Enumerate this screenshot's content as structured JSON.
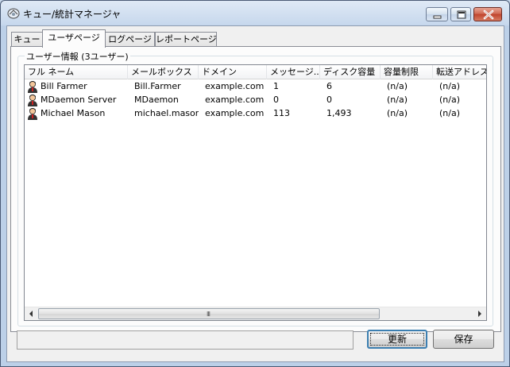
{
  "window": {
    "title": "キュー/統計マネージャ"
  },
  "tabs": [
    {
      "label": "キュー",
      "active": false
    },
    {
      "label": "ユーザページ",
      "active": true
    },
    {
      "label": "ログページ",
      "active": false
    },
    {
      "label": "レポートページ",
      "active": false
    }
  ],
  "user_group": {
    "title": "ユーザー情報 (3ユーザー)"
  },
  "columns": [
    "フル ネーム",
    "メールボックス",
    "ドメイン",
    "メッセージ...",
    "ディスク容量",
    "容量制限",
    "転送アドレス"
  ],
  "users": [
    {
      "full_name": "Bill Farmer",
      "mailbox": "Bill.Farmer",
      "domain": "example.com",
      "messages": "1",
      "disk": "6",
      "quota": "(n/a)",
      "forward": "(n/a)"
    },
    {
      "full_name": "MDaemon Server",
      "mailbox": "MDaemon",
      "domain": "example.com",
      "messages": "0",
      "disk": "0",
      "quota": "(n/a)",
      "forward": "(n/a)"
    },
    {
      "full_name": "Michael Mason",
      "mailbox": "michael.mason",
      "domain": "example.com",
      "messages": "113",
      "disk": "1,493",
      "quota": "(n/a)",
      "forward": "(n/a)"
    }
  ],
  "scrollbar": {
    "grip": "III"
  },
  "buttons": {
    "refresh": "更新",
    "save": "保存"
  },
  "icons": {
    "app": "queue-stats-icon",
    "user": "user-icon"
  }
}
